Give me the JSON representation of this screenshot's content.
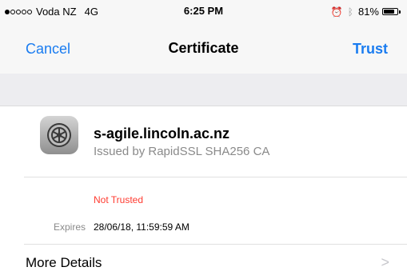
{
  "status_bar": {
    "carrier": "Voda NZ",
    "network": "4G",
    "time": "6:25 PM",
    "battery_percent": "81%",
    "battery_level": 0.81,
    "signal_bars_filled": 1,
    "signal_bars_total": 5
  },
  "nav": {
    "cancel_label": "Cancel",
    "title": "Certificate",
    "trust_label": "Trust"
  },
  "certificate": {
    "name": "s-agile.lincoln.ac.nz",
    "issuer": "Issued by RapidSSL SHA256 CA",
    "status": "Not Trusted",
    "expires_label": "Expires",
    "expires_value": "28/06/18, 11:59:59 AM"
  },
  "more_details": {
    "label": "More Details",
    "chevron": ">"
  },
  "colors": {
    "accent": "#1a7cf0",
    "danger": "#ff3b30"
  },
  "icons": [
    "signal-dots-icon",
    "alarm-icon",
    "bluetooth-icon",
    "battery-icon",
    "settings-gear-icon",
    "chevron-right-icon"
  ]
}
